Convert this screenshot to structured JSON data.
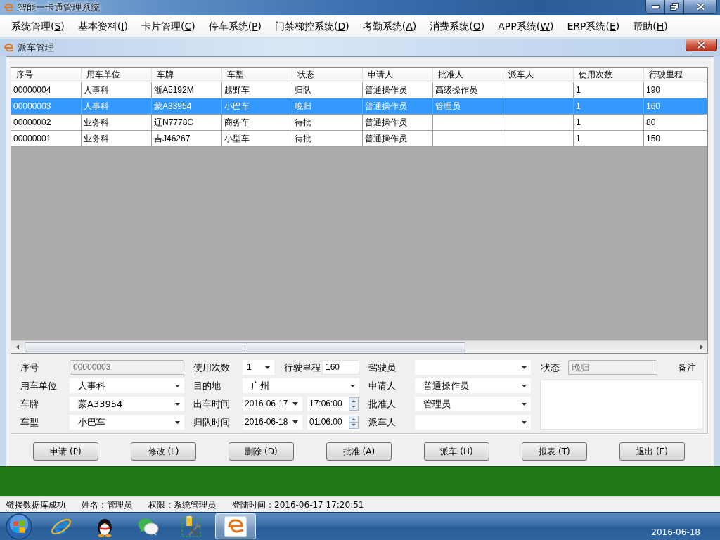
{
  "window": {
    "title": "智能一卡通管理系统"
  },
  "menu": [
    {
      "text": "系统管理(",
      "key": "S",
      "after": ")"
    },
    {
      "text": "基本资料(",
      "key": "I",
      "after": ")"
    },
    {
      "text": "卡片管理(",
      "key": "C",
      "after": ")"
    },
    {
      "text": "停车系统(",
      "key": "P",
      "after": ")"
    },
    {
      "text": "门禁梯控系统(",
      "key": "D",
      "after": ")"
    },
    {
      "text": "考勤系统(",
      "key": "A",
      "after": ")"
    },
    {
      "text": "消费系统(",
      "key": "O",
      "after": ")"
    },
    {
      "text": "APP系统(",
      "key": "W",
      "after": ")"
    },
    {
      "text": "ERP系统(",
      "key": "E",
      "after": ")"
    },
    {
      "text": "帮助(",
      "key": "H",
      "after": ")"
    }
  ],
  "dialog": {
    "title": "派车管理",
    "table": {
      "columns": [
        "序号",
        "用车单位",
        "车牌",
        "车型",
        "状态",
        "申请人",
        "批准人",
        "派车人",
        "使用次数",
        "行驶里程"
      ],
      "rows": [
        {
          "selected": false,
          "cells": [
            "00000004",
            "人事科",
            "浙A5192M",
            "越野车",
            "归队",
            "普通操作员",
            "高级操作员",
            null,
            "1",
            "190"
          ]
        },
        {
          "selected": true,
          "cells": [
            "00000003",
            "人事科",
            "蒙A33954",
            "小巴车",
            "晚归",
            "普通操作员",
            "管理员",
            null,
            "1",
            "160"
          ]
        },
        {
          "selected": false,
          "cells": [
            "00000002",
            "业务科",
            "辽N7778C",
            "商务车",
            "待批",
            "普通操作员",
            null,
            null,
            "1",
            "80"
          ]
        },
        {
          "selected": false,
          "cells": [
            "00000001",
            "业务科",
            "吉J46267",
            "小型车",
            "待批",
            "普通操作员",
            null,
            null,
            "1",
            "150"
          ]
        }
      ]
    },
    "form": {
      "columns": [
        [
          {
            "kind": "text",
            "label": "序号",
            "value": "00000003",
            "disabled": true
          },
          {
            "kind": "combo",
            "label": "用车单位",
            "value": "人事科",
            "disabled": false
          },
          {
            "kind": "combo",
            "label": "车牌",
            "value": "蒙A33954",
            "disabled": false
          },
          {
            "kind": "combo",
            "label": "车型",
            "value": "小巴车",
            "disabled": false
          }
        ],
        [
          {
            "kind": "pair",
            "label": "使用次数",
            "value": "1",
            "extra_label": "行驶里程",
            "extra_value": "160",
            "disabled": false
          },
          {
            "kind": "combo",
            "label": "目的地",
            "value": "广州",
            "disabled": false
          },
          {
            "kind": "datetime",
            "label": "出车时间",
            "date": "2016-06-17",
            "time": "17:06:00",
            "disabled": false
          },
          {
            "kind": "datetime",
            "label": "归队时间",
            "date": "2016-06-18",
            "time": "01:06:00",
            "disabled": false
          }
        ],
        [
          {
            "kind": "combo",
            "label": "驾驶员",
            "disabled": false
          },
          {
            "kind": "combo",
            "label": "申请人",
            "value": "普通操作员",
            "disabled": false
          },
          {
            "kind": "combo",
            "label": "批准人",
            "value": "管理员",
            "disabled": false
          },
          {
            "kind": "combo",
            "label": "派车人",
            "disabled": false
          }
        ]
      ],
      "status": {
        "label": "状态",
        "value": "晚归",
        "disabled": true
      },
      "remarks": {
        "label": "备注"
      }
    },
    "buttons": [
      "申请 (P)",
      "修改 (L)",
      "删除 (D)",
      "批准 (A)",
      "派车 (H)",
      "报表 (T)",
      "退出 (E)"
    ]
  },
  "status_bar": [
    "链接数据库成功",
    "姓名：管理员",
    "权限：系统管理员",
    "登陆时间：2016-06-17 17:20:51"
  ],
  "taskbar": {
    "buttons": [
      {
        "selected": false
      },
      {
        "selected": false
      },
      {
        "selected": false
      },
      {
        "selected": false
      },
      {
        "selected": true
      }
    ],
    "date": "2016-06-18"
  }
}
